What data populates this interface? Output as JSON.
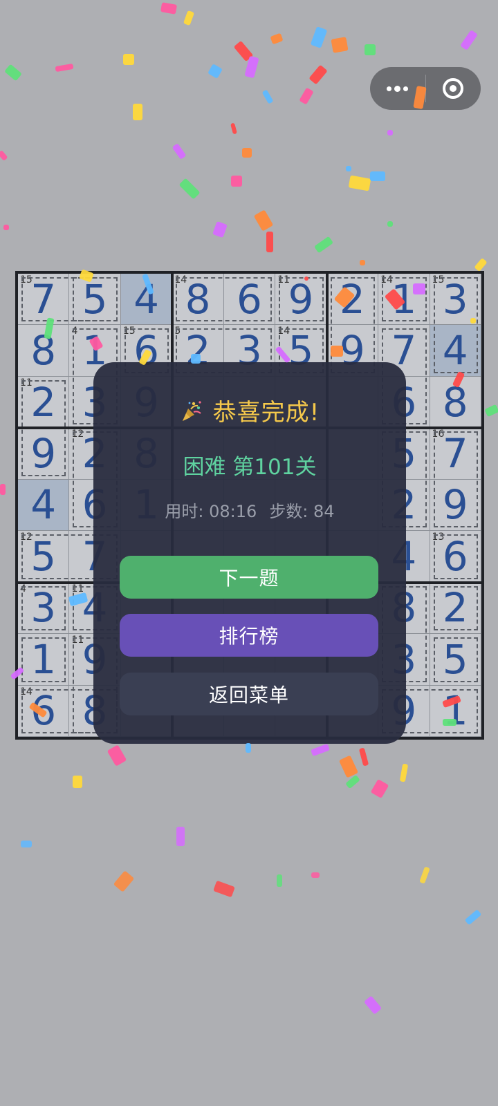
{
  "modal": {
    "title": "恭喜完成!",
    "level": "困难 第101关",
    "time_label": "用时: 08:16",
    "steps_label": "步数: 84",
    "buttons": {
      "next": "下一题",
      "leaderboard": "排行榜",
      "menu": "返回菜单"
    }
  },
  "board": {
    "values": [
      [
        7,
        5,
        4,
        8,
        6,
        9,
        2,
        1,
        3
      ],
      [
        8,
        1,
        6,
        2,
        3,
        5,
        9,
        7,
        4
      ],
      [
        2,
        3,
        9,
        "",
        "",
        "",
        "",
        6,
        8
      ],
      [
        9,
        2,
        8,
        "",
        "",
        "",
        "",
        5,
        7
      ],
      [
        4,
        6,
        1,
        "",
        "",
        "",
        "",
        2,
        9
      ],
      [
        5,
        7,
        "",
        "",
        "",
        "",
        "",
        4,
        6
      ],
      [
        3,
        4,
        "",
        "",
        "",
        "",
        "",
        8,
        2
      ],
      [
        1,
        9,
        "",
        "",
        "",
        "",
        "",
        3,
        5
      ],
      [
        6,
        8,
        "",
        "",
        "",
        "",
        "",
        9,
        1
      ]
    ],
    "cage_sums": [
      {
        "r": 0,
        "c": 0,
        "sum": "15"
      },
      {
        "r": 0,
        "c": 3,
        "sum": "14"
      },
      {
        "r": 0,
        "c": 5,
        "sum": "11"
      },
      {
        "r": 0,
        "c": 7,
        "sum": "14"
      },
      {
        "r": 0,
        "c": 8,
        "sum": "15"
      },
      {
        "r": 1,
        "c": 1,
        "sum": "4"
      },
      {
        "r": 1,
        "c": 2,
        "sum": "15"
      },
      {
        "r": 1,
        "c": 3,
        "sum": "5"
      },
      {
        "r": 1,
        "c": 5,
        "sum": "14"
      },
      {
        "r": 2,
        "c": 0,
        "sum": "11"
      },
      {
        "r": 3,
        "c": 1,
        "sum": "12"
      },
      {
        "r": 3,
        "c": 8,
        "sum": "16"
      },
      {
        "r": 5,
        "c": 0,
        "sum": "12"
      },
      {
        "r": 5,
        "c": 8,
        "sum": "13"
      },
      {
        "r": 6,
        "c": 0,
        "sum": "4"
      },
      {
        "r": 6,
        "c": 1,
        "sum": "11"
      },
      {
        "r": 7,
        "c": 1,
        "sum": "11"
      },
      {
        "r": 8,
        "c": 0,
        "sum": "14"
      }
    ],
    "highlighted": [
      [
        0,
        2
      ],
      [
        1,
        8
      ],
      [
        4,
        0
      ]
    ]
  },
  "colors": {
    "digit": "#2a4f93",
    "title": "#f5c94b",
    "level": "#5fd3a0",
    "next_button": "#4fb06d",
    "leaderboard_button": "#6850b7",
    "menu_button": "#3a3f53"
  },
  "icons": {
    "title_icon": "party-popper-icon",
    "capsule_more": "more-dots-icon",
    "capsule_close": "target-close-icon"
  }
}
